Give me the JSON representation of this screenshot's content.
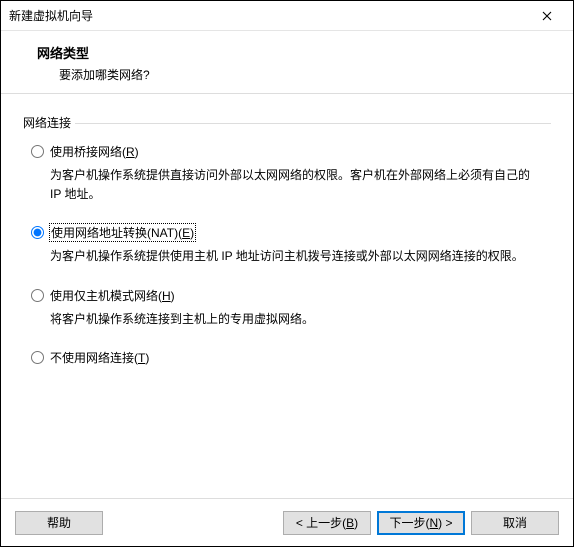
{
  "titlebar": {
    "title": "新建虚拟机向导"
  },
  "header": {
    "title": "网络类型",
    "subtitle": "要添加哪类网络?"
  },
  "group": {
    "label": "网络连接"
  },
  "options": {
    "bridged": {
      "label_pre": "使用桥接网络(",
      "mnemonic": "R",
      "label_post": ")",
      "desc": "为客户机操作系统提供直接访问外部以太网网络的权限。客户机在外部网络上必须有自己的 IP 地址。"
    },
    "nat": {
      "label_pre": "使用网络地址转换(NAT)(",
      "mnemonic": "E",
      "label_post": ")",
      "desc": "为客户机操作系统提供使用主机 IP 地址访问主机拨号连接或外部以太网网络连接的权限。"
    },
    "hostonly": {
      "label_pre": "使用仅主机模式网络(",
      "mnemonic": "H",
      "label_post": ")",
      "desc": "将客户机操作系统连接到主机上的专用虚拟网络。"
    },
    "none": {
      "label_pre": "不使用网络连接(",
      "mnemonic": "T",
      "label_post": ")"
    }
  },
  "footer": {
    "help": "帮助",
    "back_pre": "< 上一步(",
    "back_mn": "B",
    "back_post": ")",
    "next_pre": "下一步(",
    "next_mn": "N",
    "next_post": ") >",
    "cancel": "取消"
  }
}
